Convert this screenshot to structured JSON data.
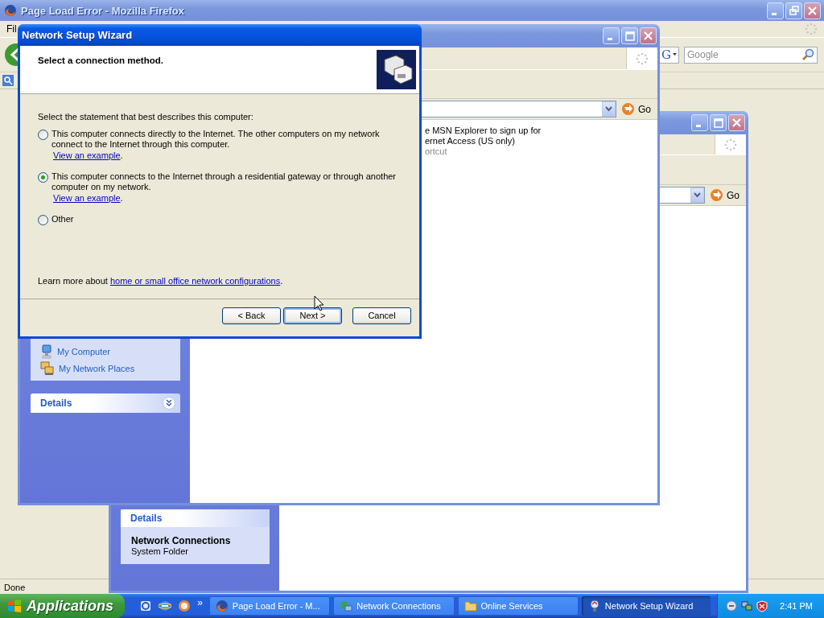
{
  "firefox": {
    "title": "Page Load Error - Mozilla Firefox",
    "menu": [
      "Fil"
    ],
    "engine_logo": "G",
    "search_placeholder": "Google",
    "status": "Done"
  },
  "network_connections": {
    "go": "Go",
    "details": {
      "title": "Details",
      "name": "Network Connections",
      "type": "System Folder"
    }
  },
  "online_services": {
    "go": "Go",
    "lines": [
      {
        "text": "e MSN Explorer to sign up for",
        "muted": false
      },
      {
        "text": "ernet Access (US only)",
        "muted": false
      },
      {
        "text": "ortcut",
        "muted": true
      }
    ],
    "places": [
      {
        "label": "My Computer",
        "kind": "computer"
      },
      {
        "label": "My Network Places",
        "kind": "network"
      }
    ],
    "details_title": "Details"
  },
  "wizard": {
    "title": "Network Setup Wizard",
    "heading": "Select a connection method.",
    "prompt": "Select the statement that best describes this computer:",
    "options": [
      {
        "text": "This computer connects directly to the Internet. The other computers on my network connect to the Internet through this computer.",
        "link": "View an example",
        "after": ".",
        "selected": false
      },
      {
        "text": "This computer connects to the Internet through a residential gateway or through another computer on my network.",
        "link": "View an example",
        "after": ".",
        "selected": true
      },
      {
        "text": "Other",
        "selected": false
      }
    ],
    "learn_more": {
      "text": "Learn more about ",
      "link": "home or small office network configurations",
      "after": "."
    },
    "buttons": [
      {
        "label": "< Back",
        "default": false
      },
      {
        "label": "Next >",
        "default": true
      },
      {
        "label": "Cancel",
        "default": false
      }
    ]
  },
  "taskbar": {
    "start": "Applications",
    "overflow": "»",
    "tasks": [
      {
        "label": "Page Load Error - M...",
        "kind": "browser",
        "selected": false
      },
      {
        "label": "Network Connections",
        "kind": "network",
        "selected": false
      },
      {
        "label": "Online Services",
        "kind": "folder",
        "selected": false
      },
      {
        "label": "Network Setup Wizard",
        "kind": "wizard",
        "selected": true
      }
    ],
    "clock": "2:41 PM"
  }
}
